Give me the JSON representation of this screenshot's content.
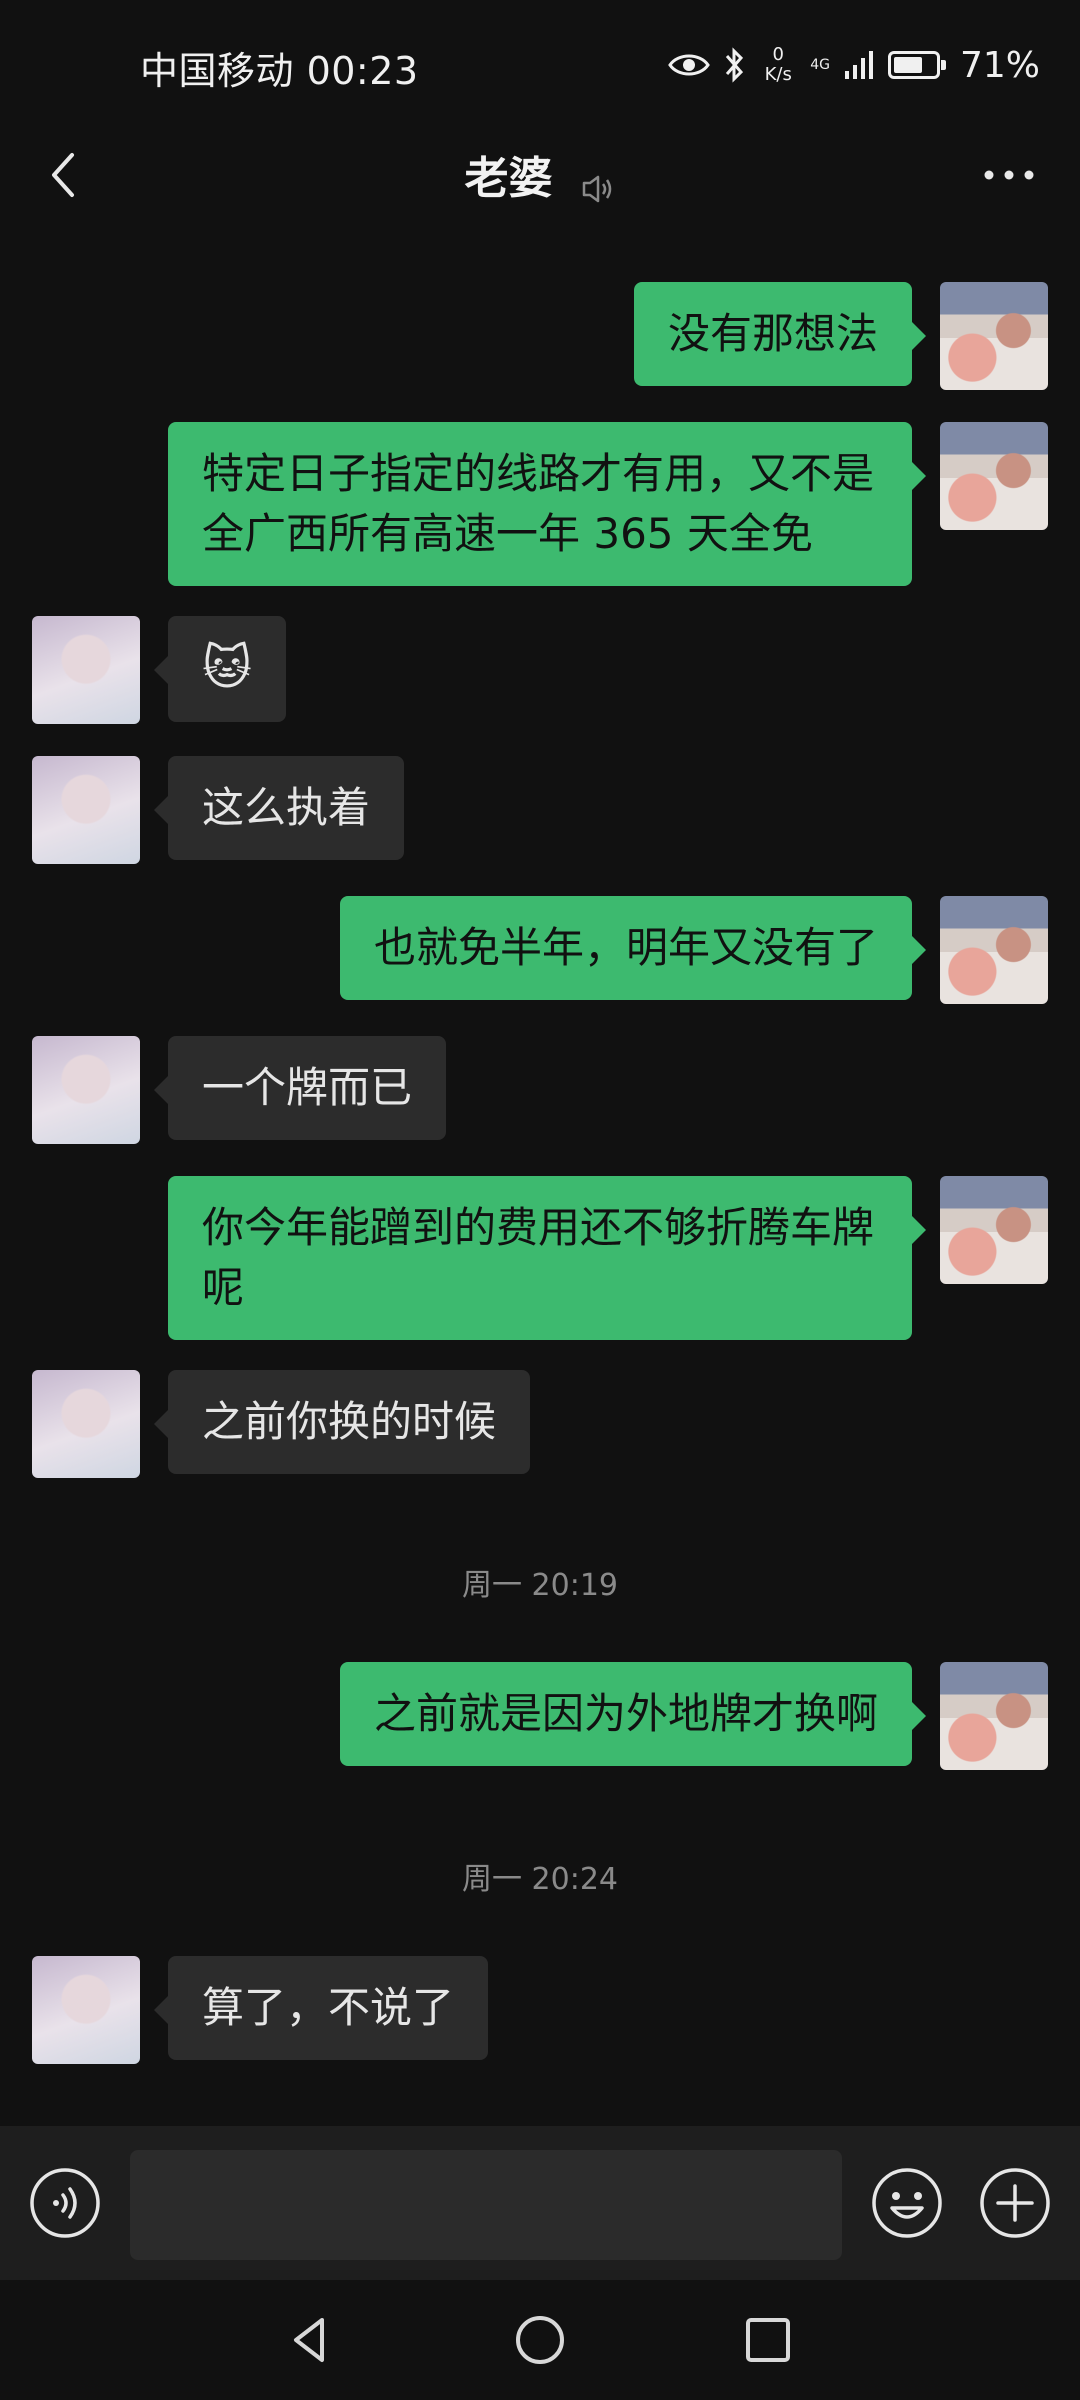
{
  "status_bar": {
    "carrier_time": "中国移动 00:23",
    "speed_value": "0",
    "speed_unit": "K/s",
    "network": "4G",
    "battery_percent": 71,
    "battery_text": "71%"
  },
  "header": {
    "title": "老婆",
    "back_icon": "chevron-left-icon",
    "muted_icon": "speaker-icon",
    "more_icon": "more-dots-icon"
  },
  "messages": [
    {
      "sender": "me",
      "text": "没有那想法"
    },
    {
      "sender": "me",
      "text": "特定日子指定的线路才有用，又不是全广西所有高速一年 365 天全免"
    },
    {
      "sender": "her",
      "text": "🐱"
    },
    {
      "sender": "her",
      "text": "这么执着"
    },
    {
      "sender": "me",
      "text": "也就免半年，明年又没有了"
    },
    {
      "sender": "her",
      "text": "一个牌而已"
    },
    {
      "sender": "me",
      "text": "你今年能蹭到的费用还不够折腾车牌呢"
    },
    {
      "sender": "her",
      "text": "之前你换的时候"
    },
    {
      "sender": "me",
      "text": "之前就是因为外地牌才换啊"
    },
    {
      "sender": "her",
      "text": "算了，不说了"
    }
  ],
  "timestamps": [
    "周一 20:19",
    "周一 20:24"
  ],
  "input_bar": {
    "placeholder": "",
    "voice_icon": "voice-icon",
    "emoji_icon": "emoji-icon",
    "plus_icon": "plus-icon"
  },
  "nav_bar": {
    "back_icon": "triangle-back-icon",
    "home_icon": "circle-home-icon",
    "recent_icon": "square-recents-icon"
  },
  "colors": {
    "background": "#111111",
    "my_bubble": "#3dba6f",
    "her_bubble": "#2c2c2c",
    "timestamp": "#8a8a8a"
  }
}
